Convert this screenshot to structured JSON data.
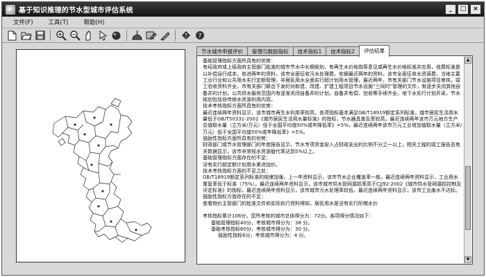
{
  "window": {
    "title": "基于知识推理的节水型城市评估系统",
    "controls": [
      "_",
      "□",
      "×"
    ]
  },
  "menu": {
    "file": "文件(F)",
    "tools": "工具(T)",
    "help": "帮助(H)"
  },
  "toolbar": {
    "icons": [
      "new-document-icon",
      "open-folder-icon",
      "save-icon",
      "zoom-in-icon",
      "zoom-out-icon",
      "pan-hand-icon",
      "pointer-icon",
      "globe-icon",
      "city-water-icon",
      "evaluate-tool-icon",
      "info-icon",
      "help-icon"
    ]
  },
  "tabs": [
    {
      "label": "节水城市申报评价",
      "active": false
    },
    {
      "label": "管理与鼓励指标",
      "active": false
    },
    {
      "label": "技术指标1",
      "active": false
    },
    {
      "label": "技术指标2",
      "active": false
    },
    {
      "label": "评估结果",
      "active": true
    }
  ],
  "result": {
    "lines": [
      {
        "text": "基础管理指标方面所具有的优势：",
        "indent": 1
      },
      {
        "text": "有经政府或上级政府主管部门批准的城市节水中长期规划，有再生水价格指导意见或再生水价格标准并应用，收费标准是以补偿运行成本，依进两年的资料，该市全面征收污水处理费，依据最近两年的资料，该市全面征收水资源费，当地主要工业行业和公共用水实行定额管理，非居民用水全面实行超计划用水管理，最近两年，市有关部门节水设施项目审核，竣工验收资料齐全，市有关部门联合下发的对新建、改建、扩建工程项目节水设施“三同时”管理的文件，有逐步关闭其他自备井的计划，公共供水服务范围内有逐渐关闭自备井的计划，自备井有偿、验收等手续齐全，地下水实行计划开采，节水规划包括非传统水资源利用内容。",
        "indent": 1
      },
      {
        "text": "技术考核指标方面所具有的优势：",
        "indent": 1
      },
      {
        "text": "最近连续两年资料显示，该市城市再生水利用率较高，各项指标基本满足GB/T18919额定系列标准，城市居民生活用水量低于GB/T50331-2002《城市居民生活用水量标准》的指标，节水器具普及率较高，最近连续两年该市万元地方生产总值取水量（立方米/万元）低于全国平均值50%或年降低率》=5%，最近连续两年该市万元工业增加值取水量（立方米/万元）低于全国平均值50%或年降低率》=5%。",
        "indent": 1
      },
      {
        "text": "鼓励性指标方面所具有的优势：",
        "indent": 1
      },
      {
        "text": "财政部门或节水管理部门的年度报告显示，节水专项资金投入占财政支出的比例不分之一以上，相关工程的竣工报告及有关数据显示，该市非常规水资源替代率达到5%以上。",
        "indent": 1
      },
      {
        "text": "基础管理指标方面存在的不足：",
        "indent": 1
      },
      {
        "text": "没有实行超定额计划用水累进加价。",
        "indent": 1
      },
      {
        "text": "技术考核指标方面的不足之处：",
        "indent": 1
      },
      {
        "text": "GB/T18919额定系列标准的规律加强，上一年资料显示，该市节水企业覆盖率一般，最近连续两年资料显示，工业用水重复率低于标准（75%），最近连续两年资料显示，该市城市供水管网漏损率高于CJJ92-2002《城市供水管网漏损控制及评定标准》的指标，最近连续两年资料显示，该市城市污水处理率较低，最近连续两年资料显示，该市工业废水不达标。",
        "indent": 1
      },
      {
        "text": "鼓励性指标方面存在的不足：",
        "indent": 1
      },
      {
        "text": "查看物价主管部门的批准文件和实际执行资料得知，居民用水是没有实行阶梯水价",
        "indent": 1
      },
      {
        "text": "",
        "indent": 1
      },
      {
        "text": "考核指标累计106分，您所考核的城市总体得分为：72分。各项得分情况如下：",
        "indent": 1
      },
      {
        "text": "基础管理指标40分，考核城市得分为：38 分。",
        "indent": 2
      },
      {
        "text": "基础考核指标60分，考核城市得分为：30 分。",
        "indent": 2
      },
      {
        "text": "鼓励性指标6分，考核城市得分为：4 分。",
        "indent": 3
      }
    ]
  }
}
